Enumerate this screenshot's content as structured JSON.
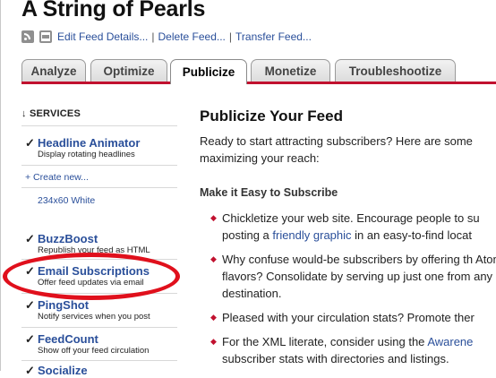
{
  "feed": {
    "title": "A String of Pearls"
  },
  "toolbar": {
    "icons": [
      "rss-icon",
      "feed-page-icon"
    ],
    "edit_details": "Edit Feed Details...",
    "separator": "|",
    "delete_feed": "Delete Feed...",
    "transfer_feed": "Transfer Feed..."
  },
  "tabs": [
    {
      "label": "Analyze",
      "active": false
    },
    {
      "label": "Optimize",
      "active": false
    },
    {
      "label": "Publicize",
      "active": true
    },
    {
      "label": "Monetize",
      "active": false
    },
    {
      "label": "Troubleshootize",
      "active": false
    }
  ],
  "sidebar": {
    "heading": "↓ SERVICES",
    "check_mark": "✓",
    "headline_animator": {
      "name": "Headline Animator",
      "desc": "Display rotating headlines"
    },
    "create_new": "+ Create new...",
    "size_white": "234x60 White",
    "buzzboost": {
      "name": "BuzzBoost",
      "desc": "Republish your feed as HTML"
    },
    "email": {
      "name": "Email Subscriptions",
      "desc": "Offer feed updates via email"
    },
    "pingshot": {
      "name": "PingShot",
      "desc": "Notify services when you post"
    },
    "feedcount": {
      "name": "FeedCount",
      "desc": "Show off your feed circulation"
    },
    "next_partial": "Socialize"
  },
  "main": {
    "title": "Publicize Your Feed",
    "intro": "Ready to start attracting subscribers? Here are some maximizing your reach:",
    "section_title": "Make it Easy to Subscribe",
    "bullet_marker": "◆",
    "bullets": {
      "b1_pre": "Chickletize your web site. Encourage people to su posting a ",
      "b1_link": "friendly graphic",
      "b1_post": " in an easy-to-find locat",
      "b2": "Why confuse would-be subscribers by offering th Atom flavors? Consolidate by serving up just one from any destination.",
      "b3": "Pleased with your circulation stats? Promote ther",
      "b4_pre": "For the XML literate, consider using the ",
      "b4_link": "Awarene",
      "b4_post": " subscriber stats with directories and listings."
    }
  },
  "colors": {
    "accent_red": "#c1112f",
    "link_blue": "#2a4f9a",
    "annotation_circle": "#e0101c"
  }
}
